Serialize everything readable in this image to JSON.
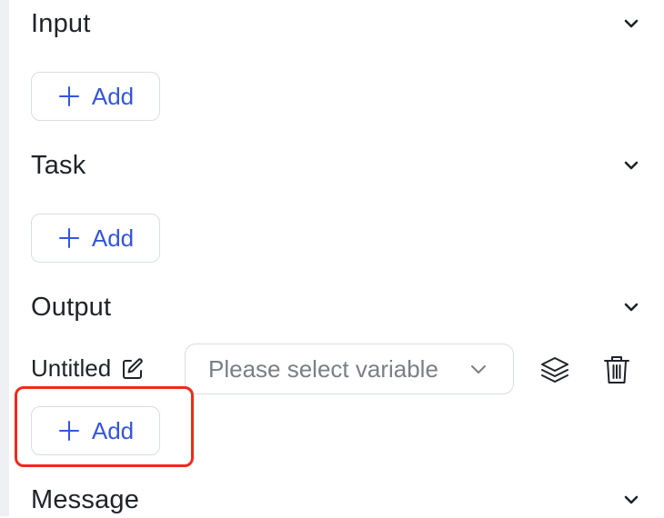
{
  "sections": {
    "input": {
      "title": "Input",
      "add_label": "Add"
    },
    "task": {
      "title": "Task",
      "add_label": "Add"
    },
    "output": {
      "title": "Output",
      "add_label": "Add",
      "variables": [
        {
          "name": "Untitled",
          "select_placeholder": "Please select variable"
        }
      ]
    },
    "message": {
      "title": "Message"
    }
  },
  "icons": {
    "collapse": "chevron-down-icon",
    "add": "plus-icon",
    "edit": "pencil-icon",
    "layers": "layers-icon",
    "delete": "trash-icon",
    "dropdown": "chevron-down-icon"
  },
  "colors": {
    "accent": "#3355e0",
    "highlight": "#f2281a",
    "border": "#d9dde3",
    "placeholder": "#7a7f87",
    "text": "#1f2329"
  }
}
